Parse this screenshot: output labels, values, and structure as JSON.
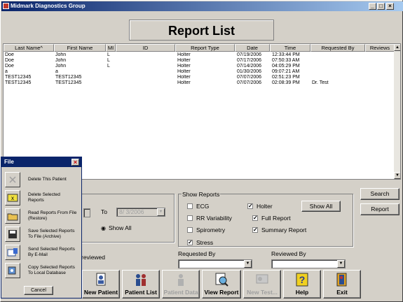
{
  "window": {
    "title": "Midmark Diagnostics Group",
    "min": "_",
    "max": "□",
    "close": "×"
  },
  "header": {
    "title": "Report List"
  },
  "table": {
    "columns": [
      "Last Name^",
      "First Name",
      "MI",
      "ID",
      "Report Type",
      "Date",
      "Time",
      "Requested By",
      "Reviews"
    ],
    "rows": [
      [
        "Doe",
        "John",
        "L",
        "",
        "Holter",
        "07/19/2006",
        "12:33:44 PM",
        "",
        ""
      ],
      [
        "Doe",
        "John",
        "L",
        "",
        "Holter",
        "07/17/2006",
        "07:50:33 AM",
        "",
        ""
      ],
      [
        "Doe",
        "John",
        "L",
        "",
        "Holter",
        "07/14/2006",
        "04:05:29 PM",
        "",
        ""
      ],
      [
        "a",
        "a",
        "",
        "",
        "Holter",
        "01/30/2006",
        "09:07:21 AM",
        "",
        ""
      ],
      [
        "TEST12345",
        "TEST12345",
        "",
        "",
        "Holter",
        "07/07/2006",
        "02:51:23 PM",
        "",
        ""
      ],
      [
        "TEST12345",
        "TEST12345",
        "",
        "",
        "Holter",
        "07/07/2006",
        "02:08:39 PM",
        "Dr. Test",
        ""
      ]
    ]
  },
  "side_buttons": {
    "search": "Search",
    "report": "Report"
  },
  "filters": {
    "to_label": "To",
    "to_date": "8/ 3/2006",
    "show_all_radio": "Show All",
    "reviewed_label": "reviewed",
    "requested_by_label": "Requested By",
    "reviewed_by_label": "Reviewed By"
  },
  "show_reports": {
    "legend": "Show Reports",
    "show_all_button": "Show All",
    "options": [
      {
        "label": "ECG",
        "checked": false
      },
      {
        "label": "Holter",
        "checked": true
      },
      {
        "label": "RR Variability",
        "checked": false
      },
      {
        "label": "Full Report",
        "checked": true
      },
      {
        "label": "Spirometry",
        "checked": false
      },
      {
        "label": "Summary Report",
        "checked": true
      },
      {
        "label": "Stress",
        "checked": true
      }
    ]
  },
  "toolbar": {
    "new_patient": "New Patient",
    "patient_list": "Patient List",
    "patient_data": "Patient Data",
    "view_report": "View Report",
    "new_test": "New Test...",
    "help": "Help",
    "exit": "Exit"
  },
  "file_palette": {
    "title": "File",
    "close": "×",
    "items": [
      "Delete This Patient",
      "Delete Selected Reports",
      "Read Reports From File (Restore)",
      "Save Selected Reports To File (Archive)",
      "Send Selected Reports By E-Mail",
      "Copy Selected Reports To Local Database"
    ],
    "cancel": "Cancel"
  },
  "colors": {
    "titlebar": "#0a246a",
    "face": "#d4d0c8"
  }
}
